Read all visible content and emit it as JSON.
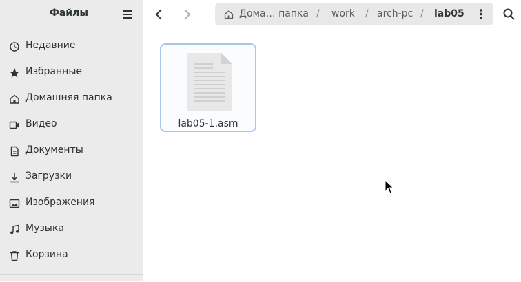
{
  "sidebar": {
    "title": "Файлы",
    "items": [
      {
        "label": "Недавние",
        "icon": "recent-icon"
      },
      {
        "label": "Избранные",
        "icon": "star-icon"
      },
      {
        "label": "Домашняя папка",
        "icon": "home-icon"
      },
      {
        "label": "Видео",
        "icon": "video-icon"
      },
      {
        "label": "Документы",
        "icon": "document-icon"
      },
      {
        "label": "Загрузки",
        "icon": "download-icon"
      },
      {
        "label": "Изображения",
        "icon": "image-icon"
      },
      {
        "label": "Музыка",
        "icon": "music-icon"
      },
      {
        "label": "Корзина",
        "icon": "trash-icon"
      }
    ]
  },
  "pathbar": {
    "home": "Дома… папка",
    "crumbs": [
      "work",
      "arch-pc"
    ],
    "current": "lab05",
    "separator": "/"
  },
  "files": [
    {
      "name": "lab05-1.asm",
      "icon": "text-file-icon",
      "selected": true
    }
  ],
  "colors": {
    "sidebar_bg": "#ebebeb",
    "pathbar_bg": "#e8e8e8",
    "selection_border": "#a9c6ea",
    "text": "#2e3436"
  }
}
